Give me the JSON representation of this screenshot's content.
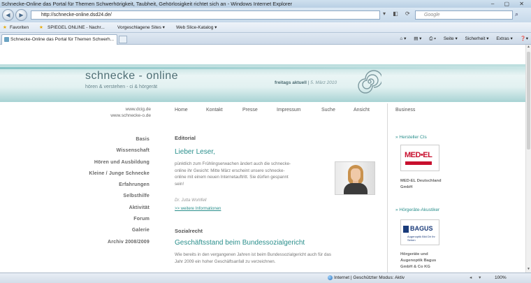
{
  "browser": {
    "title": "Schnecke-Online das Portal für Themen Schwerhörigkeit, Taubheit, Gehörlosigkeit richtet sich an - Windows Internet Explorer",
    "url": "http://schnecke-online.dsd24.de/",
    "url_host_bold": "dsd24.de",
    "search_placeholder": "Google",
    "favorites_label": "Favoriten",
    "fav_links": [
      "SPIEGEL ONLINE - Nachr...",
      "Vorgeschlagene Sites ▾",
      "Web Slice-Katalog ▾"
    ],
    "tab_label": "Schnecke-Online das Portal für Themen Schwerh...",
    "commands": [
      "Seite ▾",
      "Sicherheit ▾",
      "Extras ▾",
      "❓▾"
    ],
    "status_zone": "Internet | Geschützter Modus: Aktiv",
    "zoom": "100%"
  },
  "site": {
    "brand": "schnecke - online",
    "tagline": "hören & verstehen - ci & hörgerät",
    "freitags": "freitags aktuell",
    "date": "5. März 2010",
    "urls": [
      "www.dcig.de",
      "www.schnecke-o.de"
    ],
    "topnav": [
      "Home",
      "Kontakt",
      "Presse",
      "Impressum",
      "Suche",
      "Ansicht",
      "Business"
    ],
    "leftnav": [
      "Basis",
      "Wissenschaft",
      "Hören und Ausbildung",
      "Kleine / Junge Schnecke",
      "Erfahrungen",
      "Selbsthilfe",
      "Aktivität",
      "Forum",
      "Galerie",
      "Archiv 2008/2009"
    ]
  },
  "main": {
    "editorial_head": "Editorial",
    "editorial_title": "Lieber Leser,",
    "editorial_lines": [
      "pünktlich zum Frühlingserwachen ändert auch die schnecke-",
      "online ihr Gesicht: Mitte März erscheint unsere schnecke-",
      "online mit einem neuen Internetauftritt. Sie dürfen gespannt",
      "sein!"
    ],
    "signature": "Dr. Jutta Wohlfell",
    "more_link": ">> weitere Informationen",
    "social_head": "Sozialrecht",
    "social_title": "Geschäftsstand beim Bundessozialgericht",
    "social_lines": [
      "Wie bereits in den vergangenen Jahren ist beim Bundessozialgericht auch für das",
      "Jahr 2009 ein hoher Geschäftsanfall zu verzeichnen."
    ]
  },
  "sidebar": {
    "ci_head": "» Hersteller CIs",
    "medel_logo": "MED•EL",
    "medel_caption": [
      "MED-EL Deutschland",
      "GmbH"
    ],
    "ha_head": "» Hörgeräte-Akustiker",
    "bagus_logo": "BAGUS",
    "bagus_sub": "Augenoptik Bild Dir Ihr Sehen",
    "bagus_caption": [
      "Hörgeräte und",
      "Augenoptik Bagus",
      "GmbH & Co KG"
    ]
  }
}
